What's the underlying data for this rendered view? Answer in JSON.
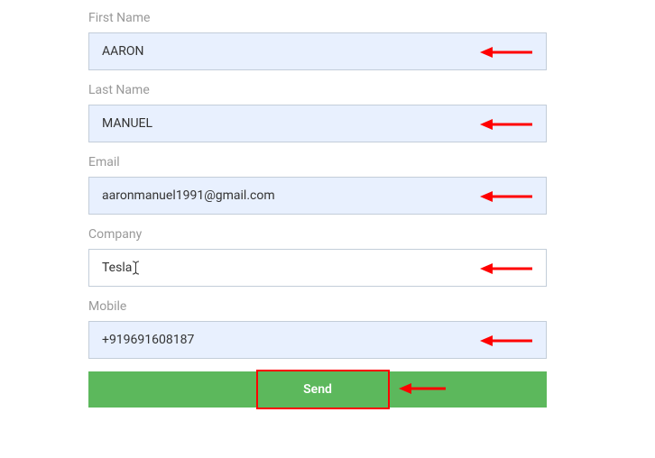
{
  "form": {
    "first_name": {
      "label": "First Name",
      "value": "AARON"
    },
    "last_name": {
      "label": "Last Name",
      "value": "MANUEL"
    },
    "email": {
      "label": "Email",
      "value": "aaronmanuel1991@gmail.com"
    },
    "company": {
      "label": "Company",
      "value": "Tesla"
    },
    "mobile": {
      "label": "Mobile",
      "value": "+919691608187"
    },
    "send_label": "Send"
  },
  "annotations": {
    "arrow_color": "#ff0000",
    "highlight_color": "#ff0000"
  }
}
